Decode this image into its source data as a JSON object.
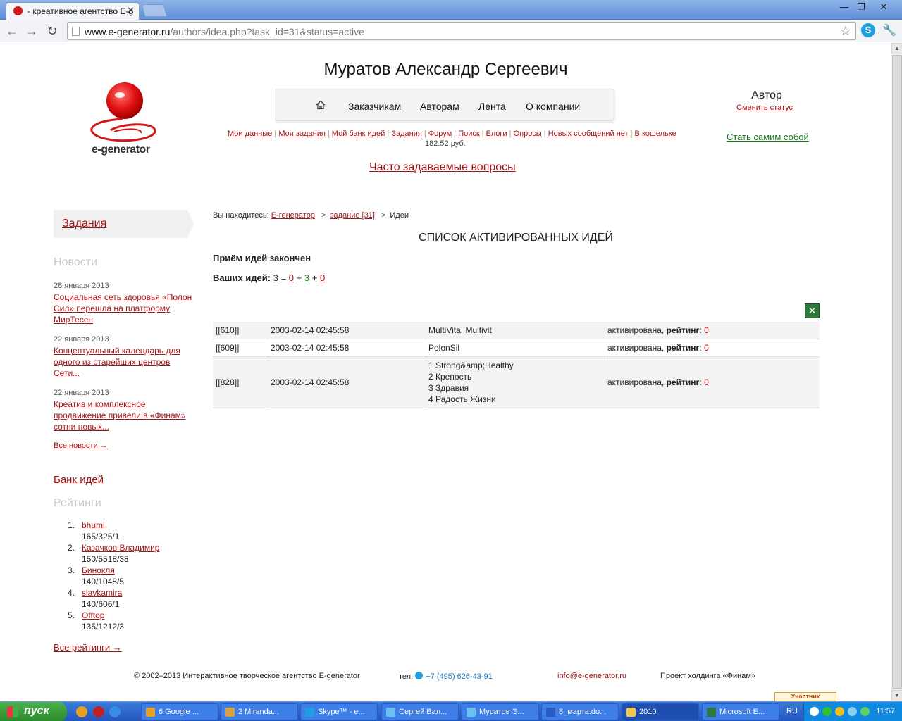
{
  "browser": {
    "tab_title": "- креативное агентство E-g",
    "tab_close": "✕",
    "url_host": "www.e-generator.ru",
    "url_path": "/authors/idea.php?task_id=31&status=active",
    "skype_letter": "S"
  },
  "header": {
    "user_name": "Муратов Александр Сергеевич",
    "logo_text": "e-generator",
    "nav": [
      {
        "label": "Заказчикам"
      },
      {
        "label": "Авторам"
      },
      {
        "label": "Лента"
      },
      {
        "label": "О компании"
      }
    ],
    "subnav": [
      {
        "label": "Мои данные"
      },
      {
        "label": "Мои задания"
      },
      {
        "label": "Мой банк идей"
      },
      {
        "label": "Задания"
      },
      {
        "label": "Форум"
      },
      {
        "label": "Поиск"
      },
      {
        "label": "Блоги"
      },
      {
        "label": "Опросы"
      },
      {
        "label": "Новых сообщений нет"
      },
      {
        "label": "В кошельке"
      }
    ],
    "balance": "182.52 руб.",
    "faq": "Часто задаваемые вопросы",
    "role": "Автор",
    "change_status": "Сменить статус",
    "be_yourself": "Стать самим собой"
  },
  "sidebar": {
    "tasks": "Задания",
    "news_heading": "Новости",
    "news": [
      {
        "date": "28 января 2013",
        "title": "Социальная сеть здоровья «Полон Сил» перешла на платформу МирТесен"
      },
      {
        "date": "22 января 2013",
        "title": "Концептуальный календарь для одного из старейших центров Сети..."
      },
      {
        "date": "22 января 2013",
        "title": "Креатив и комплексное продвижение привели в «Финам» сотни новых..."
      }
    ],
    "all_news": "Все новости →",
    "ideas_bank": "Банк идей",
    "ratings_heading": "Рейтинги",
    "ratings": [
      {
        "num": "1.",
        "name": "bhumi",
        "score": "165/325/1"
      },
      {
        "num": "2.",
        "name": "Казачков Владимир",
        "score": "150/5518/38"
      },
      {
        "num": "3.",
        "name": "Бинокля",
        "score": "140/1048/5"
      },
      {
        "num": "4.",
        "name": "slavkamira",
        "score": "140/606/1"
      },
      {
        "num": "5.",
        "name": "Offtop",
        "score": "135/1212/3"
      }
    ],
    "all_ratings": "Все рейтинги →"
  },
  "main": {
    "breadcrumb": {
      "prefix": "Вы находитесь:",
      "home": "E-генератор",
      "sep": ">",
      "task": "задание [31]",
      "current": "Идеи"
    },
    "title": "СПИСОК АКТИВИРОВАННЫХ ИДЕЙ",
    "closed": "Приём идей закончен",
    "your_ideas": {
      "label": "Ваших идей:",
      "total": "3",
      "eq": "=",
      "a": "0",
      "plus": "+",
      "b": "3",
      "c": "0",
      "color_a": "#a01515",
      "color_b": "#1a7a1a",
      "color_c": "#c00000"
    },
    "excel_glyph": "✕",
    "status_label": "активирована,",
    "rating_label": "рейтинг",
    "rows": [
      {
        "id": "[[610]]",
        "date": "2003-02-14 02:45:58",
        "name": [
          "MultiVita, Multivit"
        ],
        "rating": "0"
      },
      {
        "id": "[[609]]",
        "date": "2003-02-14 02:45:58",
        "name": [
          "PolonSil"
        ],
        "rating": "0"
      },
      {
        "id": "[[828]]",
        "date": "2003-02-14 02:45:58",
        "name": [
          "1 Strong&amp;Healthy",
          "2 Крепость",
          "3 Здравия",
          "4 Радость Жизни"
        ],
        "rating": "0"
      }
    ]
  },
  "footer": {
    "copyright": "© 2002–2013 Интерактивное творческое агентство E-generator",
    "phone_label": "тел.",
    "phone": "+7 (495) 626-43-91",
    "email": "info@e-generator.ru",
    "holding": "Проект холдинга «Финам»",
    "badge": "Участник"
  },
  "taskbar": {
    "start": "пуск",
    "buttons": [
      {
        "label": "6 Google ...",
        "color": "#e8a020"
      },
      {
        "label": "2 Miranda...",
        "color": "#d8a040"
      },
      {
        "label": "Skype™ - e...",
        "color": "#1ea0e0"
      },
      {
        "label": "Сергей Вал...",
        "color": "#6ac0f0"
      },
      {
        "label": "Муратов Э...",
        "color": "#6ac0f0"
      },
      {
        "label": "8_марта.do...",
        "color": "#2a5cc0"
      },
      {
        "label": "2010",
        "color": "#f0c850"
      },
      {
        "label": "Microsoft E...",
        "color": "#2c7a3a"
      }
    ],
    "lang": "RU",
    "clock": "11:57"
  }
}
